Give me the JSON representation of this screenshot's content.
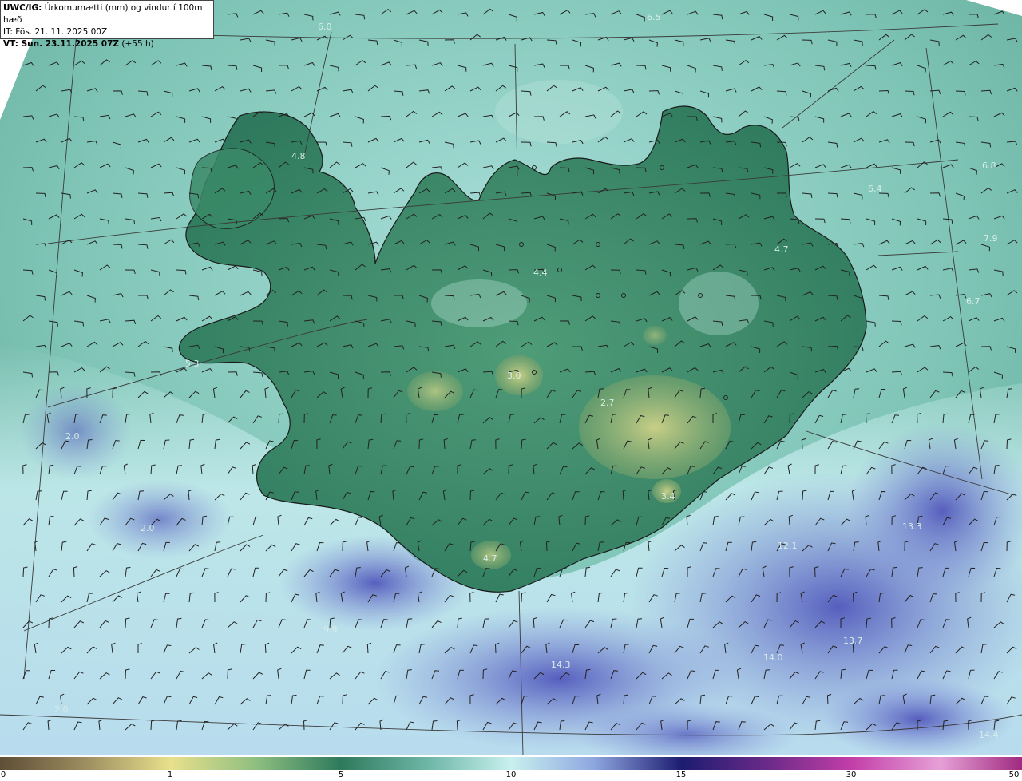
{
  "header": {
    "line1_bold": "UWC/IG:",
    "line1_text": "Úrkomumætti (mm) og vindur í 100m hæð",
    "line2": "IT: Fös. 21. 11. 2025 00Z",
    "line3_bold": "VT: Sun. 23.11.2025 07Z",
    "line3_text": "(+55 h)"
  },
  "colorbar": {
    "ticks": [
      {
        "label": "0",
        "value": 0
      },
      {
        "label": "1",
        "value": 1
      },
      {
        "label": "5",
        "value": 5
      },
      {
        "label": "10",
        "value": 10
      },
      {
        "label": "15",
        "value": 15
      },
      {
        "label": "30",
        "value": 30
      },
      {
        "label": "50",
        "value": 50
      }
    ],
    "colors": {
      "low": "#6b5a3e",
      "dry": "#e8dc8a",
      "green": "#2f7a5a",
      "teal": "#7fc9bf",
      "cyan": "#c9f0ee",
      "blue": "#5a68c8",
      "navy": "#1a1a6a",
      "magenta": "#c23aa8",
      "pink": "#e8a8d8"
    }
  },
  "value_labels": [
    {
      "text": "6.0"
    },
    {
      "text": "6.5"
    },
    {
      "text": "4.8"
    },
    {
      "text": "6.8"
    },
    {
      "text": "6.4"
    },
    {
      "text": "4.7"
    },
    {
      "text": "7.9"
    },
    {
      "text": "4.4"
    },
    {
      "text": "6.7"
    },
    {
      "text": "5.3"
    },
    {
      "text": "3.0"
    },
    {
      "text": "2.7"
    },
    {
      "text": "2.0"
    },
    {
      "text": "3.4"
    },
    {
      "text": "2.0"
    },
    {
      "text": "13.3"
    },
    {
      "text": "4.7"
    },
    {
      "text": "12.1"
    },
    {
      "text": "13.7"
    },
    {
      "text": "14.3"
    },
    {
      "text": "14.0"
    },
    {
      "text": "9.9"
    },
    {
      "text": "14.4"
    },
    {
      "text": "2.0"
    }
  ]
}
